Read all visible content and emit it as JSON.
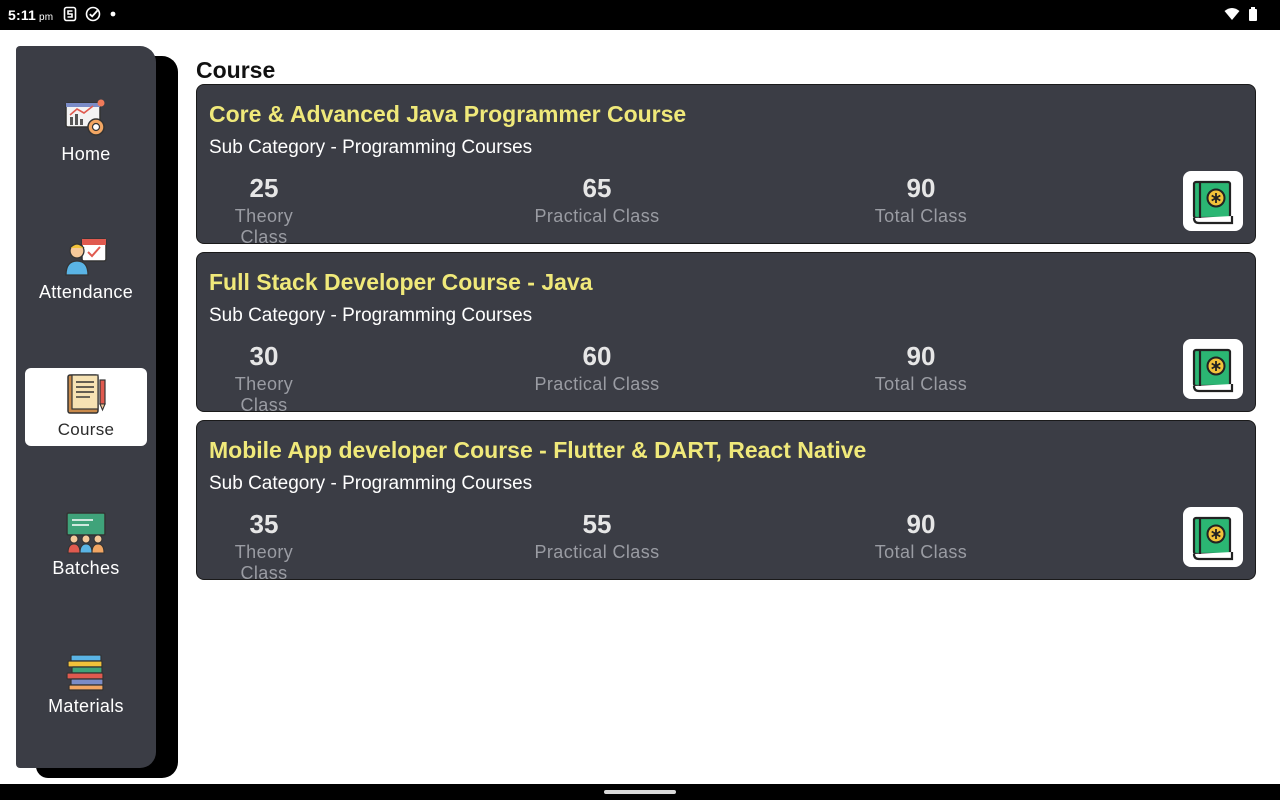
{
  "status_bar": {
    "time": "5:11",
    "ampm": "pm"
  },
  "sidebar": {
    "items": [
      {
        "label": "Home",
        "icon": "dashboard-chart-icon",
        "active": false
      },
      {
        "label": "Attendance",
        "icon": "attendance-calendar-icon",
        "active": false
      },
      {
        "label": "Course",
        "icon": "course-book-icon",
        "active": true
      },
      {
        "label": "Batches",
        "icon": "classroom-batches-icon",
        "active": false
      },
      {
        "label": "Materials",
        "icon": "books-stack-icon",
        "active": false
      }
    ]
  },
  "main": {
    "title": "Course",
    "courses": [
      {
        "title": "Core & Advanced Java Programmer Course",
        "sub_category": "Sub Category - Programming Courses",
        "theory_value": "25",
        "theory_label": "Theory Class",
        "practical_value": "65",
        "practical_label": "Practical Class",
        "total_value": "90",
        "total_label": "Total Class"
      },
      {
        "title": "Full Stack Developer Course - Java",
        "sub_category": "Sub Category - Programming Courses",
        "theory_value": "30",
        "theory_label": "Theory Class",
        "practical_value": "60",
        "practical_label": "Practical Class",
        "total_value": "90",
        "total_label": "Total Class"
      },
      {
        "title": "Mobile App developer Course - Flutter & DART, React Native",
        "sub_category": "Sub Category - Programming Courses",
        "theory_value": "35",
        "theory_label": "Theory Class",
        "practical_value": "55",
        "practical_label": "Practical Class",
        "total_value": "90",
        "total_label": "Total Class"
      }
    ]
  },
  "colors": {
    "card_bg": "#3b3d45",
    "title_accent": "#f0e97a",
    "book_green": "#2bb673"
  }
}
